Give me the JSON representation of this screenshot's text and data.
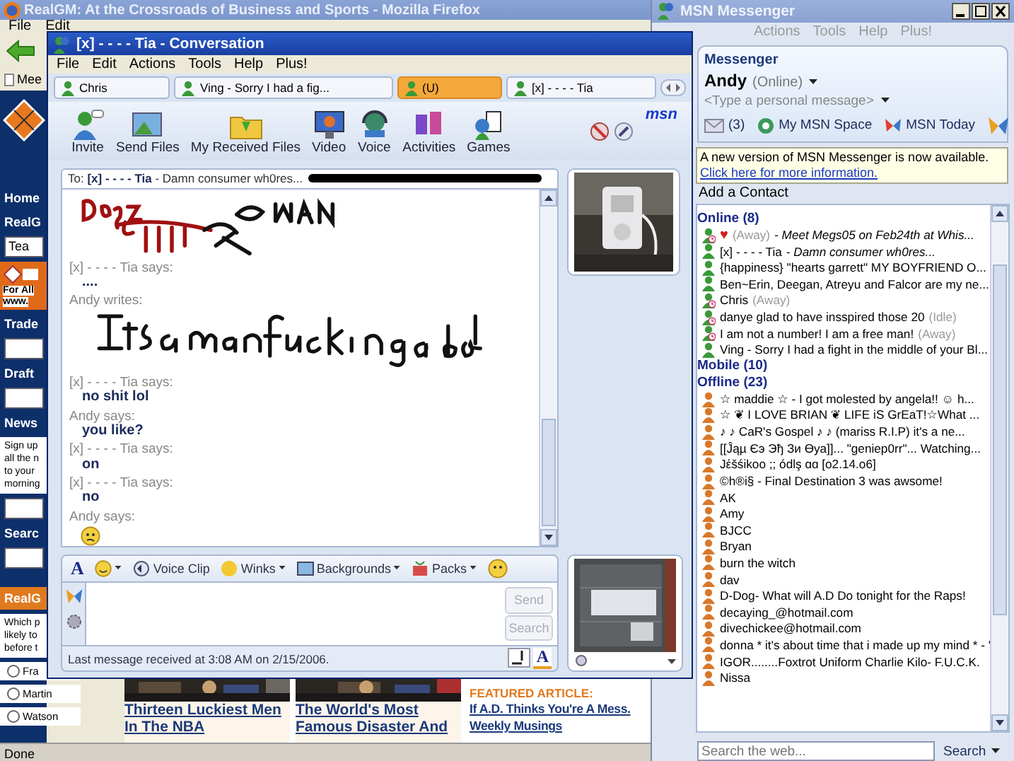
{
  "browser": {
    "title": "RealGM: At the Crossroads of Business and Sports - Mozilla Firefox",
    "menu": [
      "File",
      "Edit"
    ],
    "bookmark": "Mee",
    "sidebar": [
      {
        "kind": "heading",
        "text": "Home"
      },
      {
        "kind": "heading",
        "text": "RealG"
      },
      {
        "kind": "field",
        "value": "Tea"
      },
      {
        "kind": "ad",
        "lines": [
          "For All",
          "www."
        ]
      },
      {
        "kind": "heading",
        "text": "Trade"
      },
      {
        "kind": "field"
      },
      {
        "kind": "heading",
        "text": "Draft"
      },
      {
        "kind": "field"
      },
      {
        "kind": "heading",
        "text": "News"
      },
      {
        "kind": "text",
        "lines": [
          "Sign up",
          "all the n",
          "to your",
          "morning"
        ]
      },
      {
        "kind": "field"
      },
      {
        "kind": "heading",
        "text": "Searc"
      },
      {
        "kind": "field"
      },
      {
        "kind": "orange-heading",
        "text": "RealG"
      },
      {
        "kind": "text",
        "lines": [
          "Which p",
          "likely to",
          "before t"
        ]
      },
      {
        "kind": "radio",
        "text": "Fra",
        "checked": false
      },
      {
        "kind": "radio",
        "text": "Martin",
        "checked": false
      },
      {
        "kind": "radio",
        "text": "Watson",
        "checked": false
      }
    ],
    "articles": [
      {
        "headline": "Thirteen Luckiest Men In The NBA"
      },
      {
        "headline": "The World's Most Famous Disaster And"
      }
    ],
    "featured": {
      "label": "FEATURED ARTICLE:",
      "headline": "If A.D. Thinks You're A Mess.",
      "subhead": "Weekly Musings"
    },
    "status": "Done"
  },
  "conversation": {
    "title": "[x] - - - - Tia - Conversation",
    "menu": [
      "File",
      "Edit",
      "Actions",
      "Tools",
      "Help",
      "Plus!"
    ],
    "tabs": [
      {
        "label": "Chris",
        "selected": false
      },
      {
        "label": "Ving - Sorry I had a fig...",
        "selected": false
      },
      {
        "label": "(U)",
        "selected": true
      },
      {
        "label": "[x] - - - - Tia",
        "selected": false
      }
    ],
    "toolbar": [
      "Invite",
      "Send Files",
      "My Received Files",
      "Video",
      "Voice",
      "Activities",
      "Games"
    ],
    "logo": "msn",
    "to": {
      "label": "To:",
      "name": "[x] - - - - Tia",
      "message": "- Damn consumer wh0res..."
    },
    "messages": [
      {
        "kind": "ink"
      },
      {
        "kind": "sender",
        "text": "[x] - - - - Tia says:"
      },
      {
        "kind": "text",
        "text": "...."
      },
      {
        "kind": "sender",
        "text": "Andy writes:"
      },
      {
        "kind": "ink"
      },
      {
        "kind": "sender",
        "text": "[x] - - - - Tia says:"
      },
      {
        "kind": "text",
        "text": "no shit lol"
      },
      {
        "kind": "sender",
        "text": "Andy says:"
      },
      {
        "kind": "text",
        "text": "you like?"
      },
      {
        "kind": "sender",
        "text": "[x] - - - - Tia says:"
      },
      {
        "kind": "text",
        "text": "on"
      },
      {
        "kind": "sender",
        "text": "[x] - - - - Tia says:"
      },
      {
        "kind": "text",
        "text": "no"
      },
      {
        "kind": "sender",
        "text": "Andy says:"
      },
      {
        "kind": "emoticon"
      }
    ],
    "font_button": "A",
    "input_toolbar": [
      "Voice Clip",
      "Winks",
      "Backgrounds",
      "Packs"
    ],
    "buttons": [
      {
        "label": "Send",
        "disabled": true
      },
      {
        "label": "Search",
        "disabled": true
      }
    ],
    "status": "Last message received at 3:08 AM on 2/15/2006.",
    "text_mode": "A"
  },
  "messenger": {
    "title": "MSN Messenger",
    "menu": [
      "Actions",
      "Tools",
      "Help",
      "Plus!"
    ],
    "brand": "Messenger",
    "user": "Andy",
    "user_status": "(Online)",
    "personal_message": "<Type a personal message>",
    "mail_count": "(3)",
    "links": [
      "My MSN Space",
      "MSN Today"
    ],
    "notice": "A new version of MSN Messenger is now available.",
    "notice_link": "Click here for more information.",
    "add_contact": "Add a Contact",
    "contacts": [
      {
        "kind": "group",
        "label": "Online (8)"
      },
      {
        "kind": "contact",
        "online": true,
        "away": true,
        "name": "♥",
        "status": "(Away)",
        "message": "- Meet Megs05 on Feb24th at Whis..."
      },
      {
        "kind": "contact",
        "online": true,
        "away": false,
        "name": "[x] - - - - Tia",
        "message": "- Damn consumer wh0res..."
      },
      {
        "kind": "contact",
        "online": true,
        "away": false,
        "name": "{happiness} \"hearts garrett\"  MY BOYFRIEND O..."
      },
      {
        "kind": "contact",
        "online": true,
        "away": false,
        "name": "Ben~Erin, Deegan, Atreyu and Falcor are my ne..."
      },
      {
        "kind": "contact",
        "online": true,
        "away": true,
        "name": "Chris",
        "status": "(Away)"
      },
      {
        "kind": "contact",
        "online": true,
        "away": true,
        "name": "danye glad to have insspired those 20",
        "status": "(Idle)"
      },
      {
        "kind": "contact",
        "online": true,
        "away": true,
        "name": "I am not a number! I am a free man!",
        "status": "(Away)"
      },
      {
        "kind": "contact",
        "online": true,
        "away": false,
        "name": "Ving - Sorry I had a fight in the middle of your Bl..."
      },
      {
        "kind": "group",
        "label": "Mobile (10)"
      },
      {
        "kind": "group",
        "label": "Offline (23)"
      },
      {
        "kind": "contact",
        "online": false,
        "away": false,
        "name": "☆ maddie ☆ - I got molested by angela!! ☺ h..."
      },
      {
        "kind": "contact",
        "online": false,
        "away": false,
        "name": "☆ ❦ I LOVE BRIAN ❦ LIFE iS GrEaT!☆What ..."
      },
      {
        "kind": "contact",
        "online": false,
        "away": false,
        "name": "♪ ♪ CaR's Gospel ♪ ♪ (mariss R.I.P) it's a ne..."
      },
      {
        "kind": "contact",
        "online": false,
        "away": false,
        "name": "[[Ĵąµ Єэ Эђ Зи Өуа]]... \"geniep0rr\"... Watching..."
      },
      {
        "kind": "contact",
        "online": false,
        "away": false,
        "name": "Jέšśikoo ;;  ódlş ɑɑ   [o2.14.o6]"
      },
      {
        "kind": "contact",
        "online": false,
        "away": false,
        "name": "©h®i§ - Final Destination 3  was awsome!"
      },
      {
        "kind": "contact",
        "online": false,
        "away": false,
        "name": "AK"
      },
      {
        "kind": "contact",
        "online": false,
        "away": false,
        "name": "Amy"
      },
      {
        "kind": "contact",
        "online": false,
        "away": false,
        "name": "BJCC"
      },
      {
        "kind": "contact",
        "online": false,
        "away": false,
        "name": "Bryan"
      },
      {
        "kind": "contact",
        "online": false,
        "away": false,
        "name": "burn the witch"
      },
      {
        "kind": "contact",
        "online": false,
        "away": false,
        "name": "dav"
      },
      {
        "kind": "contact",
        "online": false,
        "away": false,
        "name": "D-Dog- What will A.D Do tonight for the Raps!"
      },
      {
        "kind": "contact",
        "online": false,
        "away": false,
        "name": "decaying_@hotmail.com"
      },
      {
        "kind": "contact",
        "online": false,
        "away": false,
        "name": "divechickee@hotmail.com"
      },
      {
        "kind": "contact",
        "online": false,
        "away": false,
        "name": "donna * it's about time that i made up my mind * - '"
      },
      {
        "kind": "contact",
        "online": false,
        "away": false,
        "name": "IGOR........Foxtrot Uniform  Charlie Kilo- F.U.C.K."
      },
      {
        "kind": "contact",
        "online": false,
        "away": false,
        "name": "Nissa"
      }
    ],
    "search": {
      "placeholder": "Search the web...",
      "button": "Search"
    }
  }
}
